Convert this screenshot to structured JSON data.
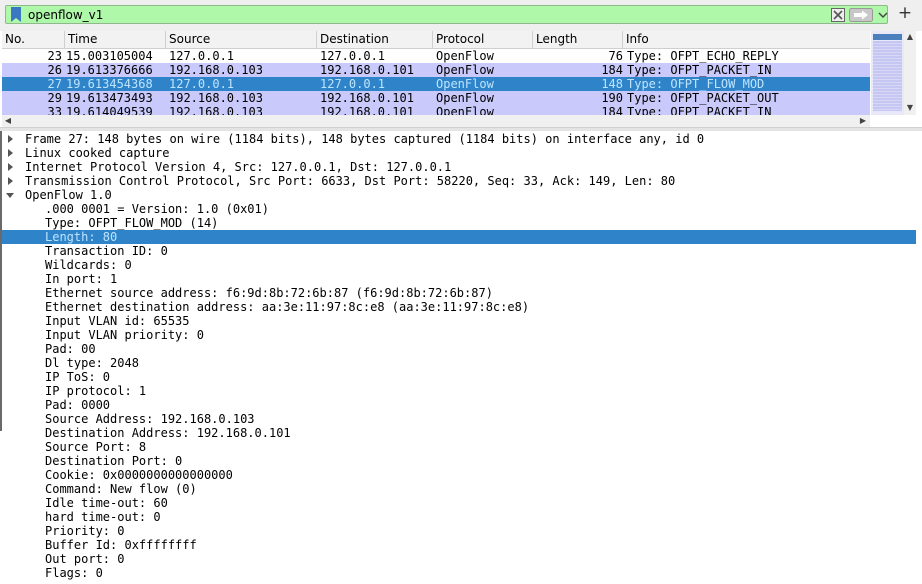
{
  "filter": {
    "text": "openflow_v1",
    "icons": {
      "bookmark": "bookmark-icon",
      "clear": "clear-icon",
      "apply": "apply-arrow-icon",
      "dropdown": "chevron-down-icon",
      "add": "plus-icon"
    },
    "add_label": "+"
  },
  "packet_list": {
    "columns": [
      "No.",
      "Time",
      "Source",
      "Destination",
      "Protocol",
      "Length",
      "Info"
    ],
    "rows": [
      {
        "no": "23",
        "time": "15.003105004",
        "source": "127.0.0.1",
        "destination": "127.0.0.1",
        "protocol": "OpenFlow",
        "length": "76",
        "info": "Type: OFPT_ECHO_REPLY",
        "style": "white"
      },
      {
        "no": "26",
        "time": "19.613376666",
        "source": "192.168.0.103",
        "destination": "192.168.0.101",
        "protocol": "OpenFlow",
        "length": "184",
        "info": "Type: OFPT_PACKET_IN",
        "style": "lavender"
      },
      {
        "no": "27",
        "time": "19.613454368",
        "source": "127.0.0.1",
        "destination": "127.0.0.1",
        "protocol": "OpenFlow",
        "length": "148",
        "info": "Type: OFPT_FLOW_MOD",
        "style": "selected"
      },
      {
        "no": "29",
        "time": "19.613473493",
        "source": "192.168.0.103",
        "destination": "192.168.0.101",
        "protocol": "OpenFlow",
        "length": "190",
        "info": "Type: OFPT_PACKET_OUT",
        "style": "lavender"
      },
      {
        "no": "33",
        "time": "19.614049539",
        "source": "192.168.0.103",
        "destination": "192.168.0.101",
        "protocol": "OpenFlow",
        "length": "184",
        "info": "Type: OFPT_PACKET_IN",
        "style": "lavender"
      }
    ]
  },
  "details": {
    "rows": [
      {
        "text": "Frame 27: 148 bytes on wire (1184 bits), 148 bytes captured (1184 bits) on interface any, id 0",
        "level": 0,
        "expander": "collapsed"
      },
      {
        "text": "Linux cooked capture",
        "level": 0,
        "expander": "collapsed"
      },
      {
        "text": "Internet Protocol Version 4, Src: 127.0.0.1, Dst: 127.0.0.1",
        "level": 0,
        "expander": "collapsed"
      },
      {
        "text": "Transmission Control Protocol, Src Port: 6633, Dst Port: 58220, Seq: 33, Ack: 149, Len: 80",
        "level": 0,
        "expander": "collapsed"
      },
      {
        "text": "OpenFlow 1.0",
        "level": 0,
        "expander": "expanded"
      },
      {
        "text": ".000 0001 = Version: 1.0 (0x01)",
        "level": 1
      },
      {
        "text": "Type: OFPT_FLOW_MOD (14)",
        "level": 1
      },
      {
        "text": "Length: 80",
        "level": 1,
        "selected": true
      },
      {
        "text": "Transaction ID: 0",
        "level": 1
      },
      {
        "text": "Wildcards: 0",
        "level": 1
      },
      {
        "text": "In port: 1",
        "level": 1
      },
      {
        "text": "Ethernet source address: f6:9d:8b:72:6b:87 (f6:9d:8b:72:6b:87)",
        "level": 1
      },
      {
        "text": "Ethernet destination address: aa:3e:11:97:8c:e8 (aa:3e:11:97:8c:e8)",
        "level": 1
      },
      {
        "text": "Input VLAN id: 65535",
        "level": 1
      },
      {
        "text": "Input VLAN priority: 0",
        "level": 1
      },
      {
        "text": "Pad: 00",
        "level": 1
      },
      {
        "text": "Dl type: 2048",
        "level": 1
      },
      {
        "text": "IP ToS: 0",
        "level": 1
      },
      {
        "text": "IP protocol: 1",
        "level": 1
      },
      {
        "text": "Pad: 0000",
        "level": 1
      },
      {
        "text": "Source Address: 192.168.0.103",
        "level": 1
      },
      {
        "text": "Destination Address: 192.168.0.101",
        "level": 1
      },
      {
        "text": "Source Port: 8",
        "level": 1
      },
      {
        "text": "Destination Port: 0",
        "level": 1
      },
      {
        "text": "Cookie: 0x0000000000000000",
        "level": 1
      },
      {
        "text": "Command: New flow (0)",
        "level": 1
      },
      {
        "text": "Idle time-out: 60",
        "level": 1
      },
      {
        "text": "hard time-out: 0",
        "level": 1
      },
      {
        "text": "Priority: 0",
        "level": 1
      },
      {
        "text": "Buffer Id: 0xffffffff",
        "level": 1
      },
      {
        "text": "Out port: 0",
        "level": 1
      },
      {
        "text": "Flags: 0",
        "level": 1
      }
    ]
  },
  "colors": {
    "filter_bg": "#aff8a9",
    "row_lavender": "#c9c9fb",
    "row_selected": "#2f84c9",
    "row_selected_text": "#bde4ff",
    "details_selected": "#2f84c9"
  }
}
